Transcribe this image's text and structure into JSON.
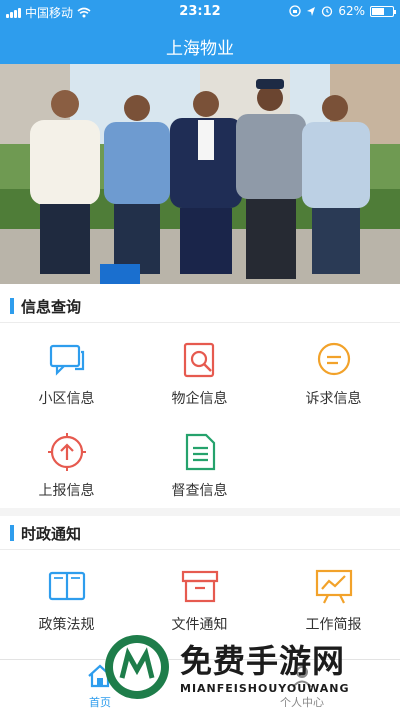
{
  "status_bar": {
    "carrier": "中国移动",
    "time": "23:12",
    "battery": "62%",
    "battery_level": 0.62
  },
  "header": {
    "title": "上海物业"
  },
  "sections": [
    {
      "title": "信息查询",
      "items": [
        {
          "label": "小区信息",
          "icon": "chat-bubbles-icon",
          "color": "#2e9ded"
        },
        {
          "label": "物企信息",
          "icon": "search-document-icon",
          "color": "#e65a4f"
        },
        {
          "label": "诉求信息",
          "icon": "message-circle-icon",
          "color": "#f2a22a"
        },
        {
          "label": "上报信息",
          "icon": "upload-circle-icon",
          "color": "#e65a4f"
        },
        {
          "label": "督查信息",
          "icon": "document-list-icon",
          "color": "#25a26c"
        }
      ]
    },
    {
      "title": "时政通知",
      "items": [
        {
          "label": "政策法规",
          "icon": "book-icon",
          "color": "#2e9ded"
        },
        {
          "label": "文件通知",
          "icon": "archive-box-icon",
          "color": "#e65a4f"
        },
        {
          "label": "工作简报",
          "icon": "chart-board-icon",
          "color": "#f2a22a"
        }
      ]
    }
  ],
  "tabbar": {
    "home": "首页",
    "personal": "个人中心"
  },
  "watermark": {
    "text": "免费手游网",
    "subtext": "MIANFEISHOUYOUWANG"
  },
  "colors": {
    "primary": "#2e9ded"
  }
}
